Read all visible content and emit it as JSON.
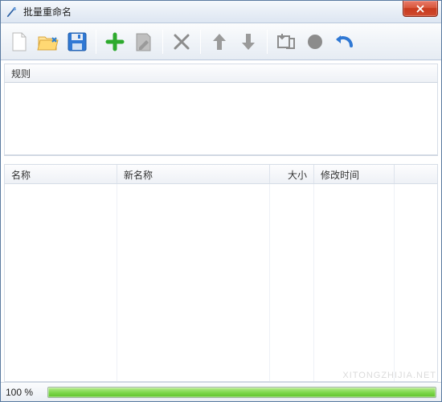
{
  "window": {
    "title": "批量重命名"
  },
  "toolbar": {
    "new_label": "新建",
    "open_label": "打开",
    "save_label": "保存",
    "add_label": "添加",
    "edit_label": "编辑",
    "delete_label": "删除",
    "up_label": "上移",
    "down_label": "下移",
    "run_label": "执行",
    "stop_label": "停止",
    "undo_label": "撤销"
  },
  "rules": {
    "header": "规则"
  },
  "columns": {
    "name": "名称",
    "new_name": "新名称",
    "size": "大小",
    "mtime": "修改时间"
  },
  "status": {
    "percent_text": "100 %",
    "percent_value": 100
  },
  "watermark": "XITONGZHIJIA.NET"
}
